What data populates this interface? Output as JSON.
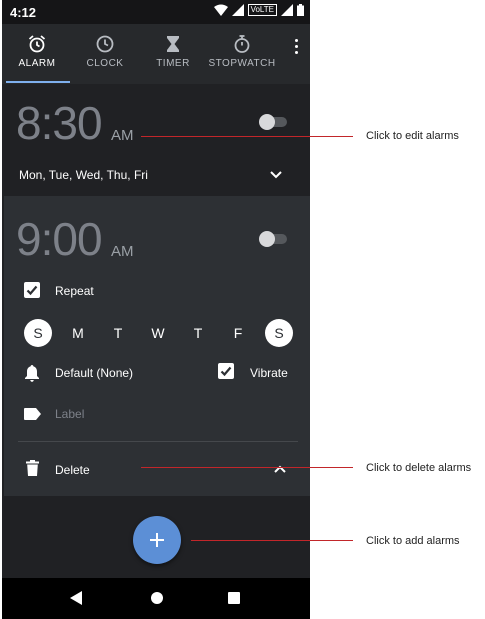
{
  "status_bar": {
    "time": "4:12",
    "volte": "VoLTE"
  },
  "tabs": [
    {
      "label": "ALARM",
      "icon": "alarm-clock-icon",
      "active": true
    },
    {
      "label": "CLOCK",
      "icon": "clock-icon",
      "active": false
    },
    {
      "label": "TIMER",
      "icon": "hourglass-icon",
      "active": false
    },
    {
      "label": "STOPWATCH",
      "icon": "stopwatch-icon",
      "active": false
    }
  ],
  "alarm1": {
    "time": "8:30",
    "ampm": "AM",
    "enabled": false,
    "days": "Mon, Tue, Wed, Thu, Fri"
  },
  "alarm2": {
    "time": "9:00",
    "ampm": "AM",
    "enabled": false,
    "repeat_label": "Repeat",
    "repeat_checked": true,
    "days": [
      {
        "letter": "S",
        "selected": true
      },
      {
        "letter": "M",
        "selected": false
      },
      {
        "letter": "T",
        "selected": false
      },
      {
        "letter": "W",
        "selected": false
      },
      {
        "letter": "T",
        "selected": false
      },
      {
        "letter": "F",
        "selected": false
      },
      {
        "letter": "S",
        "selected": true
      }
    ],
    "ringtone": "Default (None)",
    "vibrate_label": "Vibrate",
    "vibrate_checked": true,
    "label_placeholder": "Label",
    "delete_label": "Delete"
  },
  "fab": {
    "symbol": "+"
  },
  "callouts": {
    "edit": "Click to edit alarms",
    "delete": "Click to delete alarms",
    "add": "Click to add alarms"
  },
  "colors": {
    "background": "#202124",
    "accent": "#5c8fd6",
    "tab_indicator": "#7fb0ee",
    "callout_line": "#c2262a"
  }
}
